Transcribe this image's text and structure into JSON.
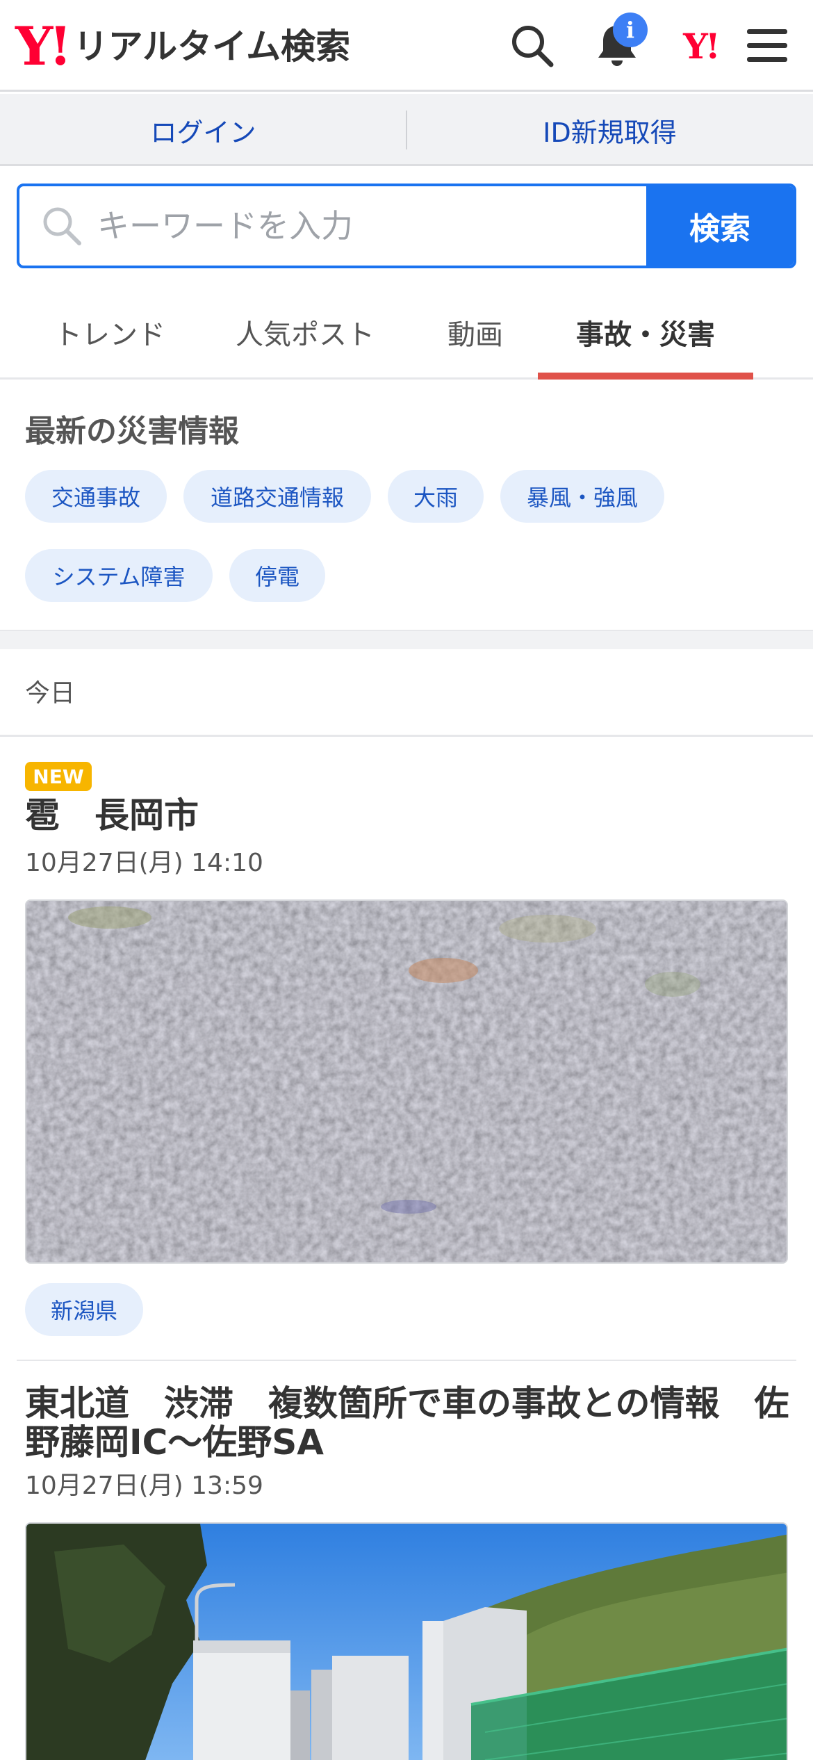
{
  "header": {
    "brand_mark": "Y!",
    "brand_text": "リアルタイム検索",
    "notification_badge": "i",
    "yahoo_link": "Y!"
  },
  "login_bar": {
    "login": "ログイン",
    "register": "ID新規取得"
  },
  "search": {
    "placeholder": "キーワードを入力",
    "value": "",
    "button": "検索"
  },
  "tabs": [
    {
      "label": "トレンド",
      "active": false
    },
    {
      "label": "人気ポスト",
      "active": false
    },
    {
      "label": "動画",
      "active": false
    },
    {
      "label": "事故・災害",
      "active": true
    }
  ],
  "disaster": {
    "title": "最新の災害情報",
    "chips": [
      "交通事故",
      "道路交通情報",
      "大雨",
      "暴風・強風",
      "システム障害",
      "停電"
    ]
  },
  "timeline": {
    "today_label": "今日"
  },
  "articles": [
    {
      "badge": "NEW",
      "title": "雹　長岡市",
      "date": "10月27日(月) 14:10",
      "tag": "新潟県"
    },
    {
      "title_line1": "東北道　渋滞　複数箇所で車の事故との情報　佐",
      "title_line2": "野藤岡IC〜佐野SA",
      "date": "10月27日(月) 13:59"
    }
  ],
  "colors": {
    "brand_red": "#ff0033",
    "link_blue": "#1549b8",
    "search_blue": "#1a73f0",
    "tab_underline": "#e0524a",
    "new_badge": "#f7b500"
  }
}
